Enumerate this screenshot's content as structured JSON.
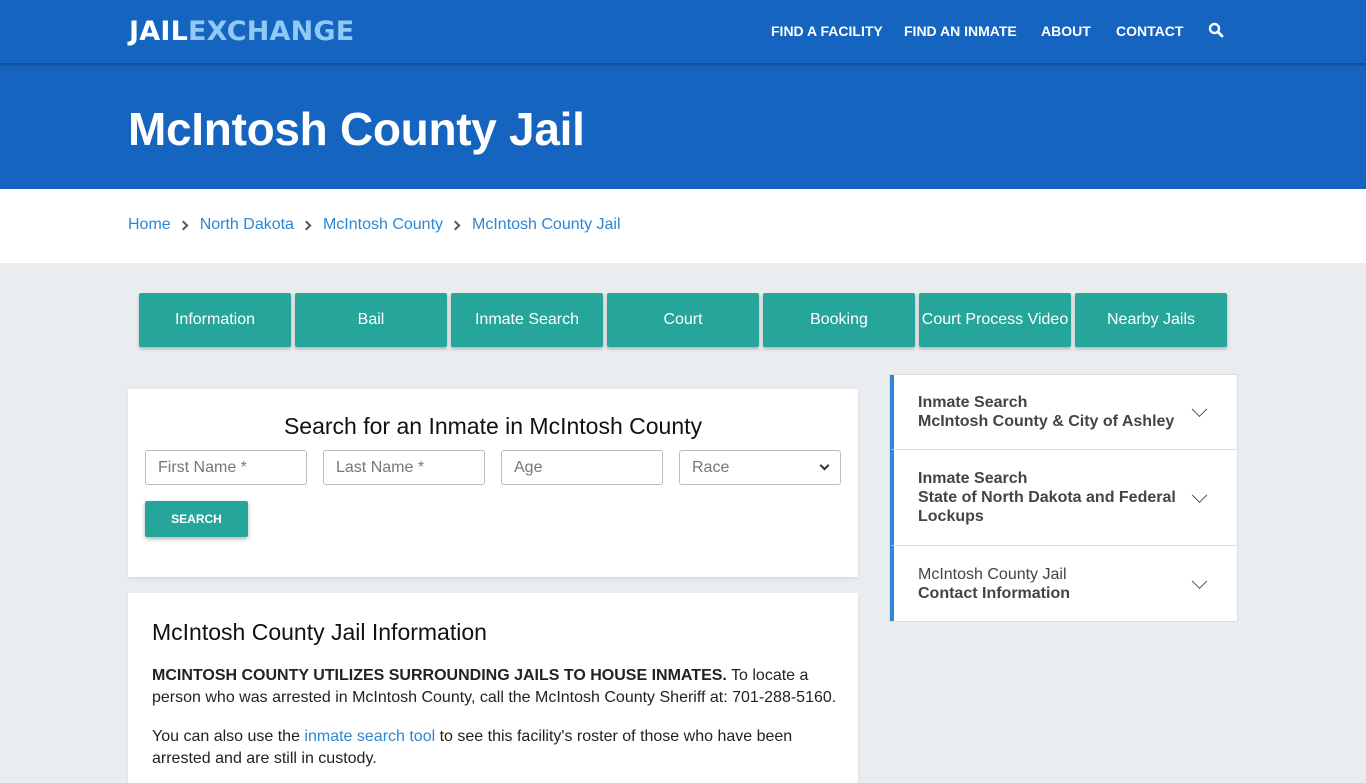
{
  "header": {
    "logo_part1": "JAIL",
    "logo_part2": "EXCHANGE",
    "nav": [
      {
        "label": "FIND A FACILITY"
      },
      {
        "label": "FIND AN INMATE"
      },
      {
        "label": "ABOUT"
      },
      {
        "label": "CONTACT"
      }
    ],
    "search_icon": "search-icon"
  },
  "hero": {
    "title": "McIntosh County Jail"
  },
  "breadcrumb": [
    {
      "label": "Home"
    },
    {
      "label": "North Dakota"
    },
    {
      "label": "McIntosh County"
    },
    {
      "label": "McIntosh County Jail"
    }
  ],
  "tabs": [
    {
      "label": "Information"
    },
    {
      "label": "Bail"
    },
    {
      "label": "Inmate Search"
    },
    {
      "label": "Court"
    },
    {
      "label": "Booking"
    },
    {
      "label": "Court Process Video"
    },
    {
      "label": "Nearby Jails"
    }
  ],
  "search": {
    "title": "Search for an Inmate in McIntosh County",
    "first_name_placeholder": "First Name *",
    "last_name_placeholder": "Last Name *",
    "age_placeholder": "Age",
    "race_selected": "Race",
    "button_label": "SEARCH"
  },
  "info": {
    "title": "McIntosh County Jail Information",
    "p1_bold": "MCINTOSH COUNTY UTILIZES SURROUNDING JAILS TO HOUSE INMATES.",
    "p1_rest": " To locate a person who was arrested in McIntosh County, call the McIntosh County Sheriff at: 701-288-5160.",
    "p2_before": "You can also use the ",
    "p2_link": "inmate search tool",
    "p2_after": " to see this facility's roster of those who have been arrested and are still in custody."
  },
  "sidebar": {
    "items": [
      {
        "line1": "Inmate Search",
        "line2": "McIntosh County & City of Ashley"
      },
      {
        "line1": "Inmate Search",
        "line2": "State of North Dakota and Federal Lockups"
      },
      {
        "line1": "McIntosh County Jail",
        "line2": "Contact Information"
      }
    ]
  },
  "colors": {
    "brand_blue": "#1565c0",
    "logo_accent": "#90c8f6",
    "teal": "#26a69a",
    "link": "#2d86d6"
  }
}
